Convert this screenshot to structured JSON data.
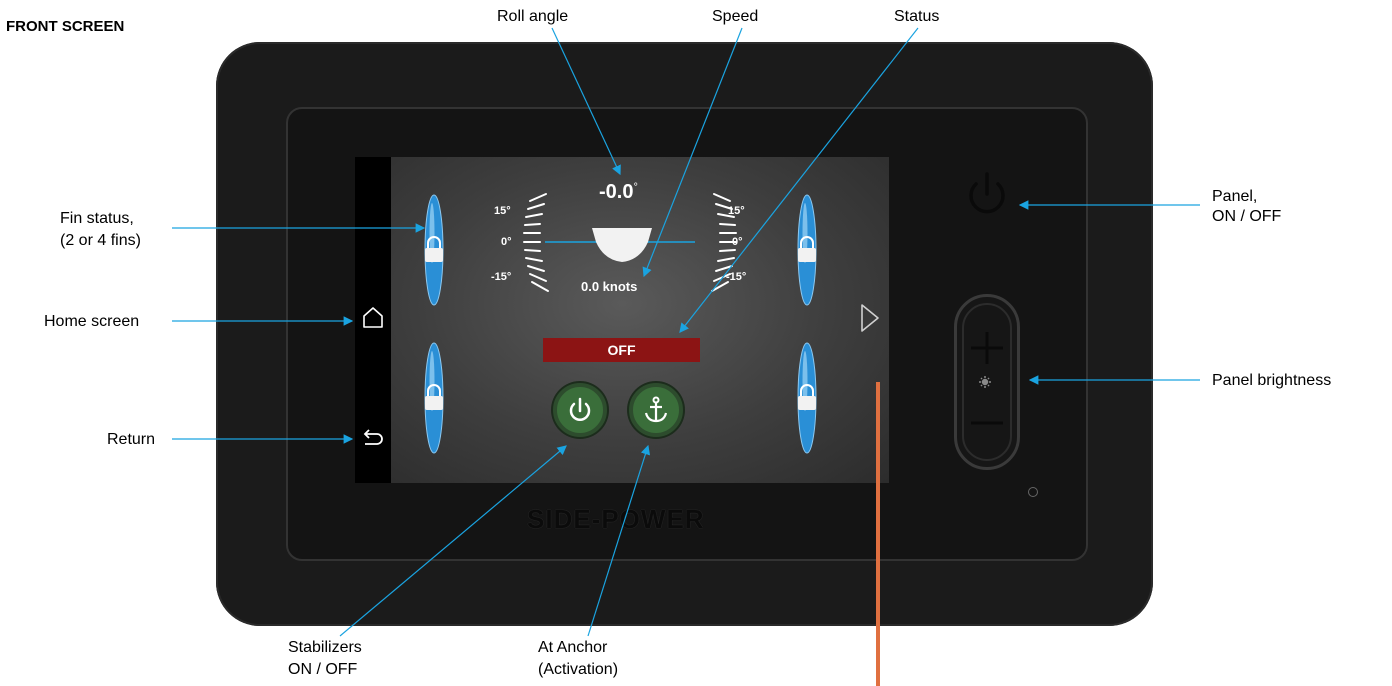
{
  "heading": "FRONT SCREEN",
  "callouts": {
    "roll_angle": "Roll angle",
    "speed": "Speed",
    "status": "Status",
    "fin_status_1": "Fin status,",
    "fin_status_2": "(2 or 4 fins)",
    "home_screen": "Home screen",
    "return": "Return",
    "panel_1": "Panel,",
    "panel_2": "ON / OFF",
    "panel_brightness": "Panel brightness",
    "stabilizers_1": "Stabilizers",
    "stabilizers_2": "ON / OFF",
    "at_anchor_1": "At Anchor",
    "at_anchor_2": "(Activation)"
  },
  "screen": {
    "roll_value": "-0.0",
    "degree": "°",
    "speed_value": "0.0 knots",
    "status": "OFF",
    "scale_left": [
      "15°",
      "0°",
      "-15°"
    ],
    "scale_right": [
      "15°",
      "0°",
      "-15°"
    ]
  },
  "brand": "SIDE-POWER",
  "colors": {
    "callout_line": "#1aa3e0",
    "fin_blue": "#2a8fd6",
    "status_red": "#8c1414",
    "button_green": "#3a6e3a",
    "marker_orange": "#e07040"
  }
}
